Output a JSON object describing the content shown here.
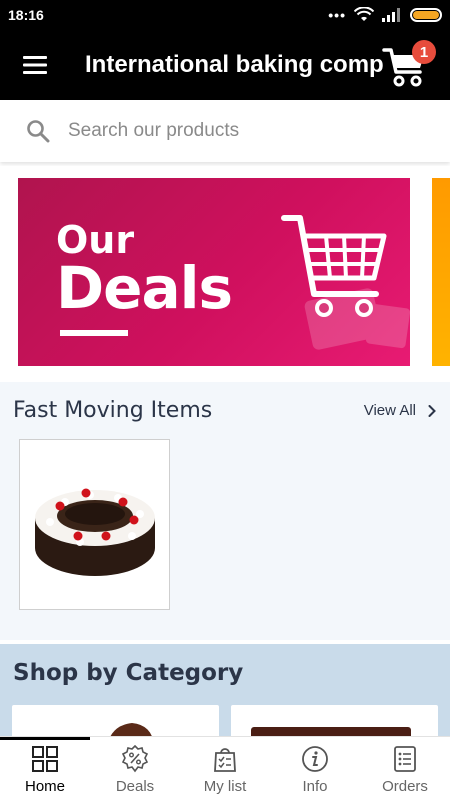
{
  "status_bar": {
    "time": "18:16",
    "battery_color": "#f5a623"
  },
  "header": {
    "title": "International baking comp",
    "cart_count": "1"
  },
  "search": {
    "placeholder": "Search our products"
  },
  "banner": {
    "line1": "Our",
    "line2": "Deals",
    "color": "#d0105e"
  },
  "fast_moving": {
    "title": "Fast Moving Items",
    "view_all": "View All",
    "products": [
      {
        "image": "black-forest-cake-image"
      }
    ]
  },
  "category": {
    "title": "Shop by Category"
  },
  "bottom_nav": {
    "items": [
      {
        "label": "Home",
        "icon": "grid-icon",
        "active": true
      },
      {
        "label": "Deals",
        "icon": "discount-badge-icon",
        "active": false
      },
      {
        "label": "My list",
        "icon": "shopping-list-icon",
        "active": false
      },
      {
        "label": "Info",
        "icon": "info-icon",
        "active": false
      },
      {
        "label": "Orders",
        "icon": "orders-icon",
        "active": false
      }
    ]
  }
}
